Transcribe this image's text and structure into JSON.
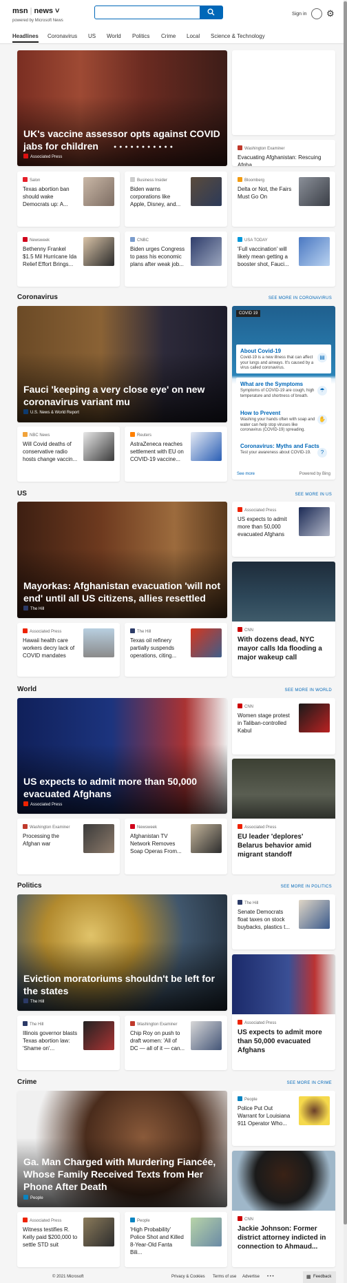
{
  "header": {
    "logo": "msn",
    "section": "news",
    "powered_by": "powered by Microsoft News",
    "search_placeholder": "",
    "sign_in": "Sign in"
  },
  "nav": [
    "Headlines",
    "Coronavirus",
    "US",
    "World",
    "Politics",
    "Crime",
    "Local",
    "Science & Technology"
  ],
  "top": {
    "hero": {
      "title": "UK's vaccine assessor opts against COVID jabs for children",
      "source": "Associated Press"
    },
    "side_small": {
      "source": "Washington Examiner",
      "title": "Evacuating Afghanistan: Rescuing Afgha..."
    },
    "cards": [
      {
        "source": "Salon",
        "title": "Texas abortion ban should wake Democrats up: A..."
      },
      {
        "source": "Business Insider",
        "title": "Biden warns corporations like Apple, Disney, and..."
      },
      {
        "source": "Bloomberg",
        "title": "Delta or Not, the Fairs Must Go On"
      },
      {
        "source": "Newsweek",
        "title": "Bethenny Frankel $1.5 Mil Hurricane Ida Relief Effort Brings..."
      },
      {
        "source": "CNBC",
        "title": "Biden urges Congress to pass his economic plans after weak job..."
      },
      {
        "source": "USA TODAY",
        "title": "'Full vaccination' will likely mean getting a booster shot, Fauci..."
      }
    ]
  },
  "coronavirus": {
    "section_title": "Coronavirus",
    "see_more": "SEE MORE IN CORONAVIRUS",
    "hero": {
      "title": "Fauci 'keeping a very close eye' on new coronavirus variant mu",
      "source": "U.S. News & World Report"
    },
    "cards": [
      {
        "source": "NBC News",
        "title": "Will Covid deaths of conservative radio hosts change vaccin..."
      },
      {
        "source": "Reuters",
        "title": "AstraZeneca reaches settlement with EU on COVID-19 vaccine..."
      }
    ],
    "info": {
      "tag": "COVID 19",
      "items": [
        {
          "title": "About Covid-19",
          "text": "Covid-19 is a new illness that can affect your lungs and airways. It's caused by a virus called coronavirus."
        },
        {
          "title": "What are the Symptoms",
          "text": "Symptoms of COVID-19 are cough, high temperature and shortness of breath."
        },
        {
          "title": "How to Prevent",
          "text": "Washing your hands often with soap and water can help stop viruses like coronavirus (COVID-19) spreading."
        },
        {
          "title": "Coronavirus: Myths and Facts",
          "text": "Test your awareness about COVID-19."
        }
      ],
      "see_more": "See more",
      "powered": "Powered by Bing"
    }
  },
  "us": {
    "section_title": "US",
    "see_more": "SEE MORE IN US",
    "hero": {
      "title": "Mayorkas: Afghanistan evacuation 'will not end' until all US citizens, allies resettled",
      "source": "The Hill"
    },
    "side_card": {
      "source": "Associated Press",
      "title": "US expects to admit more than 50,000 evacuated Afghans"
    },
    "tall": {
      "source": "CNN",
      "title": "With dozens dead, NYC mayor calls Ida flooding a major wakeup call"
    },
    "cards": [
      {
        "source": "Associated Press",
        "title": "Hawaii health care workers decry lack of COVID mandates"
      },
      {
        "source": "The Hill",
        "title": "Texas oil refinery partially suspends operations, citing..."
      }
    ]
  },
  "world": {
    "section_title": "World",
    "see_more": "SEE MORE IN WORLD",
    "hero": {
      "title": "US expects to admit more than 50,000 evacuated Afghans",
      "source": "Associated Press"
    },
    "side_card": {
      "source": "CNN",
      "title": "Women stage protest in Taliban-controlled Kabul"
    },
    "tall": {
      "source": "Associated Press",
      "title": "EU leader 'deplores' Belarus behavior amid migrant standoff"
    },
    "cards": [
      {
        "source": "Washington Examiner",
        "title": "Processing the Afghan war"
      },
      {
        "source": "Newsweek",
        "title": "Afghanistan TV Network Removes Soap Operas From..."
      }
    ]
  },
  "politics": {
    "section_title": "Politics",
    "see_more": "SEE MORE IN POLITICS",
    "hero": {
      "title": "Eviction moratoriums shouldn't be left for the states",
      "source": "The Hill"
    },
    "side_card": {
      "source": "The Hill",
      "title": "Senate Democrats float taxes on stock buybacks, plastics t..."
    },
    "tall": {
      "source": "Associated Press",
      "title": "US expects to admit more than 50,000 evacuated Afghans"
    },
    "cards": [
      {
        "source": "The Hill",
        "title": "Illinois governor blasts Texas abortion law: 'Shame on'..."
      },
      {
        "source": "Washington Examiner",
        "title": "Chip Roy on push to draft women: 'All of DC — all of it — can..."
      }
    ]
  },
  "crime": {
    "section_title": "Crime",
    "see_more": "SEE MORE IN CRIME",
    "hero": {
      "title": "Ga. Man Charged with Murdering Fiancée, Whose Family Received Texts from Her Phone After Death",
      "source": "People"
    },
    "side_card": {
      "source": "People",
      "title": "Police Put Out Warrant for Louisiana 911 Operator Who..."
    },
    "tall": {
      "source": "CNN",
      "title": "Jackie Johnson: Former district attorney indicted in connection to Ahmaud..."
    },
    "cards": [
      {
        "source": "Associated Press",
        "title": "Witness testifies R. Kelly paid $200,000 to settle STD suit"
      },
      {
        "source": "People",
        "title": "'High Probability' Police Shot and Killed 8-Year-Old Fanta Bili..."
      }
    ]
  },
  "footer": {
    "copyright": "© 2021 Microsoft",
    "privacy": "Privacy & Cookies",
    "terms": "Terms of use",
    "advertise": "Advertise",
    "more": "• • •",
    "feedback": "Feedback"
  },
  "colors": {
    "accent": "#0067b8"
  }
}
